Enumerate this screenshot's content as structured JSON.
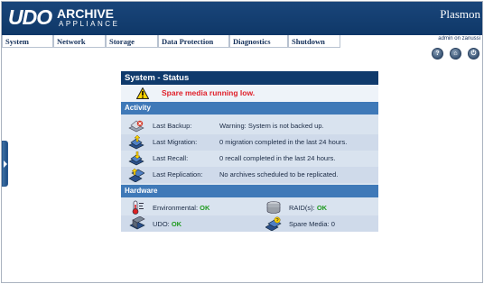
{
  "header": {
    "logo_primary": "UDO",
    "logo_secondary": "ARCHIVE",
    "logo_tagline": "APPLIANCE",
    "brand": "Plasmon",
    "user_line": "admin on zanussi"
  },
  "menu": {
    "items": [
      {
        "label": "System"
      },
      {
        "label": "Network"
      },
      {
        "label": "Storage"
      },
      {
        "label": "Data Protection"
      },
      {
        "label": "Diagnostics"
      },
      {
        "label": "Shutdown"
      }
    ]
  },
  "header_buttons": [
    {
      "icon": "help-icon",
      "glyph": "?"
    },
    {
      "icon": "home-icon",
      "glyph": "⌂"
    },
    {
      "icon": "power-icon",
      "glyph": "⏻"
    }
  ],
  "panel": {
    "title": "System - Status",
    "alert": "Spare media running low.",
    "activity": {
      "header": "Activity",
      "rows": [
        {
          "label": "Last Backup:",
          "value": "Warning: System is not backed up.",
          "icon": "backup-icon"
        },
        {
          "label": "Last Migration:",
          "value": "0 migration completed in the last 24 hours.",
          "icon": "migration-icon"
        },
        {
          "label": "Last Recall:",
          "value": "0 recall completed in the last 24 hours.",
          "icon": "recall-icon"
        },
        {
          "label": "Last Replication:",
          "value": "No archives scheduled to be replicated.",
          "icon": "replication-icon"
        }
      ]
    },
    "hardware": {
      "header": "Hardware",
      "environmental": {
        "label": "Environmental:",
        "value": "OK",
        "icon": "thermometer-icon"
      },
      "raid": {
        "label": "RAID(s):",
        "value": "OK",
        "icon": "raid-icon"
      },
      "udo": {
        "label": "UDO:",
        "value": "OK",
        "icon": "udo-drive-icon"
      },
      "spare_media": {
        "label": "Spare Media:",
        "value": "0",
        "icon": "spare-media-icon"
      }
    }
  },
  "colors": {
    "header_bg": "#0f3868",
    "panel_title_bg": "#0f3a6c",
    "section_bg": "#3f79b8",
    "alert_text": "#e0202a",
    "ok_text": "#1e9a1e"
  }
}
